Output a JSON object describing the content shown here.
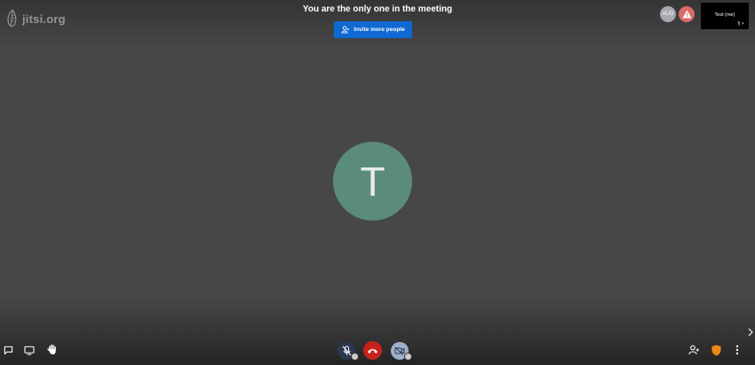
{
  "brand": {
    "logo_text": "jitsi.org"
  },
  "notice": {
    "text": "You are the only one in the meeting"
  },
  "invite": {
    "label": "Invite more people"
  },
  "participants": {
    "audio_only_label": "AUD",
    "self_view_name": "Test (me)",
    "self_view_marker": "§ ⚡"
  },
  "main_avatar": {
    "initial": "T",
    "color": "#5b8b7c"
  },
  "toolbar": {
    "left": [
      "chat-icon",
      "screenshare-icon",
      "raise-hand-icon"
    ],
    "center": [
      "microphone-muted-icon",
      "hangup-icon",
      "camera-muted-icon"
    ],
    "right": [
      "invite-participants-icon",
      "security-shield-icon",
      "more-options-icon"
    ]
  },
  "colors": {
    "background": "#474747",
    "invite_button": "#0e69d3",
    "hangup": "#c7221c",
    "shield": "#ee8a13",
    "avatar": "#5b8b7c"
  }
}
